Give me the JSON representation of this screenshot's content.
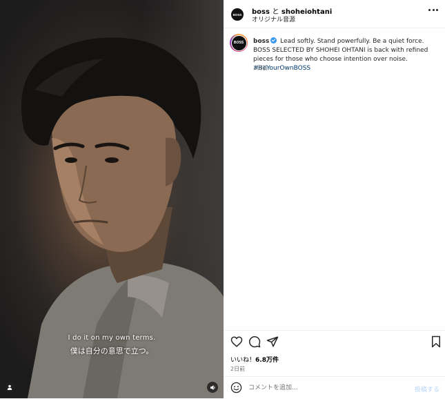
{
  "video": {
    "subtitle_en": "I do it on my own terms.",
    "subtitle_jp": "僕は自分の意思で立つ。"
  },
  "header": {
    "account": "boss",
    "connector": "と",
    "collaborator": "shoheiohtani",
    "audio": "オリジナル音源",
    "logo_text": "BOSS"
  },
  "caption": {
    "username": "boss",
    "text": "Lead softly. Stand powerfully. Be a quiet force. BOSS SELECTED BY SHOHEI OHTANI is back with refined pieces for those who choose intention over noise.",
    "hashtag": "#BeYourOwnBOSS",
    "time": "2日前",
    "logo_text": "BOSS"
  },
  "engagement": {
    "likes_label": "いいね！",
    "likes_count": "6.8万件",
    "time": "2日前"
  },
  "comment": {
    "placeholder": "コメントを追加...",
    "post_label": "投稿する"
  },
  "colors": {
    "verified": "#3897f0",
    "hashtag": "#00376b",
    "post_button_disabled": "#b3d4f7"
  },
  "icons": [
    "more-icon",
    "verified-icon",
    "heart-icon",
    "comment-icon",
    "share-icon",
    "bookmark-icon",
    "emoji-icon",
    "user-tag-icon",
    "volume-icon"
  ]
}
